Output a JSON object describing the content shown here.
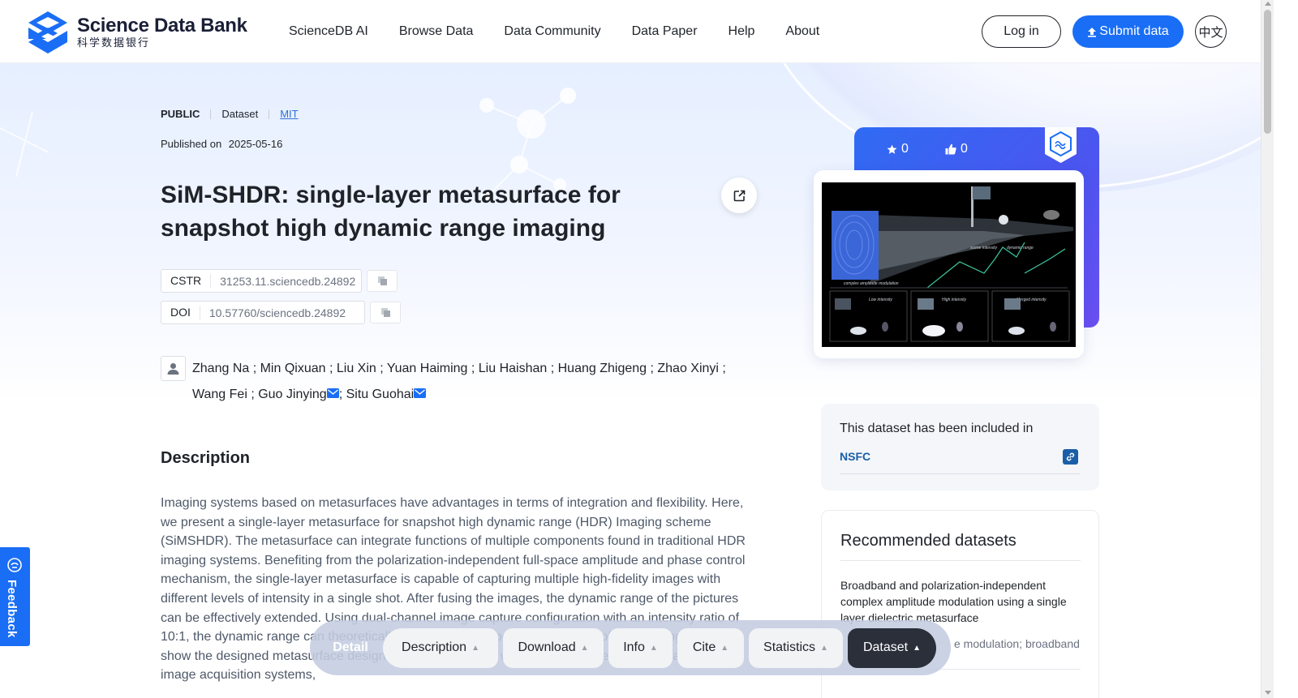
{
  "header": {
    "logo_title": "Science Data Bank",
    "logo_subtitle": "科学数据银行",
    "nav": [
      "ScienceDB AI",
      "Browse Data",
      "Data Community",
      "Data Paper",
      "Help",
      "About"
    ],
    "login": "Log in",
    "submit": "Submit data",
    "lang": "中文"
  },
  "dataset": {
    "visibility": "PUBLIC",
    "type": "Dataset",
    "license": "MIT",
    "published_label": "Published on",
    "published_date": "2025-05-16",
    "title": "SiM-SHDR: single-layer metasurface for snapshot high dynamic range imaging",
    "cstr_label": "CSTR",
    "cstr_value": "31253.11.sciencedb.24892",
    "doi_label": "DOI",
    "doi_value": "10.57760/sciencedb.24892",
    "authors_line1": "Zhang Na ; Min Qixuan ; Liu Xin ; Yuan Haiming ; Liu Haishan ; Huang Zhigeng ; Zhao Xinyi ;",
    "authors_line2_a": "Wang Fei ; Guo Jinying",
    "authors_line2_b": "; Situ Guohai"
  },
  "description": {
    "heading": "Description",
    "text": "Imaging systems based on metasurfaces have advantages in terms of integration and flexibility. Here, we present a single-layer metasurface for snapshot high dynamic range (HDR) Imaging scheme (SiMSHDR). The metasurface can integrate functions of multiple components found in traditional HDR imaging systems. Benefiting from the polarization-independent full-space amplitude and phase control mechanism, the single-layer metasurface is capable of capturing multiple high-fidelity images with different levels of intensity in a single shot. After fusing the images, the dynamic range of the pictures can be effectively extended. Using dual-channel image capture configuration with an intensity ratio of 10:1, the dynamic range can theoretically be extended. Experimental results of the imaging system show the designed metasurface design maintains a similar weight and volume to traditional single-image acquisition systems,"
  },
  "stats": {
    "stars": "0",
    "likes": "0"
  },
  "figure": {
    "label_complex": "complex amplitude modulation",
    "label_scene": "scene intensity",
    "label_dynamic": "dynamic range",
    "label_low": "Low intensity",
    "label_high": "High intensity",
    "label_merged": "Merged intensity"
  },
  "included": {
    "title": "This dataset has been included in",
    "link": "NSFC"
  },
  "recommended": {
    "title": "Recommended datasets",
    "item_title": "Broadband and polarization-independent complex amplitude modulation using a single layer dielectric metasurface",
    "item_keywords": "e modulation; broadband"
  },
  "feedback": "Feedback",
  "tabbar": {
    "detail": "Detail",
    "tabs": [
      "Description",
      "Download",
      "Info",
      "Cite",
      "Statistics",
      "Dataset"
    ]
  },
  "colors": {
    "primary": "#1a6ef5",
    "link": "#1a5ea8",
    "active_tab": "#2a2f3a"
  }
}
